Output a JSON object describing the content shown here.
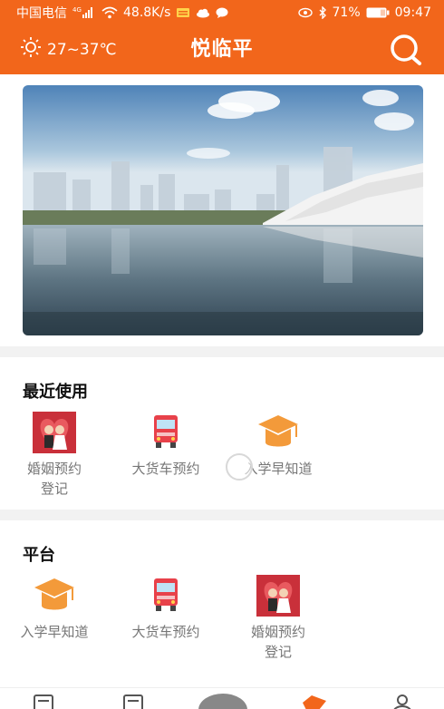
{
  "status_bar": {
    "carrier": "中国电信",
    "network_type": "4G",
    "speed": "48.8K/s",
    "battery": "71%",
    "time": "09:47"
  },
  "header": {
    "temperature": "27~37℃",
    "title": "悦临平",
    "weather_icon": "sun-icon",
    "search_icon": "search-icon"
  },
  "recent": {
    "title": "最近使用",
    "items": [
      {
        "label": "婚姻预约登记",
        "icon": "marriage-icon"
      },
      {
        "label": "大货车预约",
        "icon": "truck-icon"
      },
      {
        "label": "入学早知道",
        "icon": "graduation-cap-icon"
      }
    ]
  },
  "platform": {
    "title": "平台",
    "items": [
      {
        "label": "入学早知道",
        "icon": "graduation-cap-icon"
      },
      {
        "label": "大货车预约",
        "icon": "truck-icon"
      },
      {
        "label": "婚姻预约登记",
        "icon": "marriage-icon"
      }
    ]
  },
  "colors": {
    "brand": "#f2661b",
    "truck": "#e8414a",
    "cap": "#f39a3a",
    "marriage": "#c9303a"
  }
}
